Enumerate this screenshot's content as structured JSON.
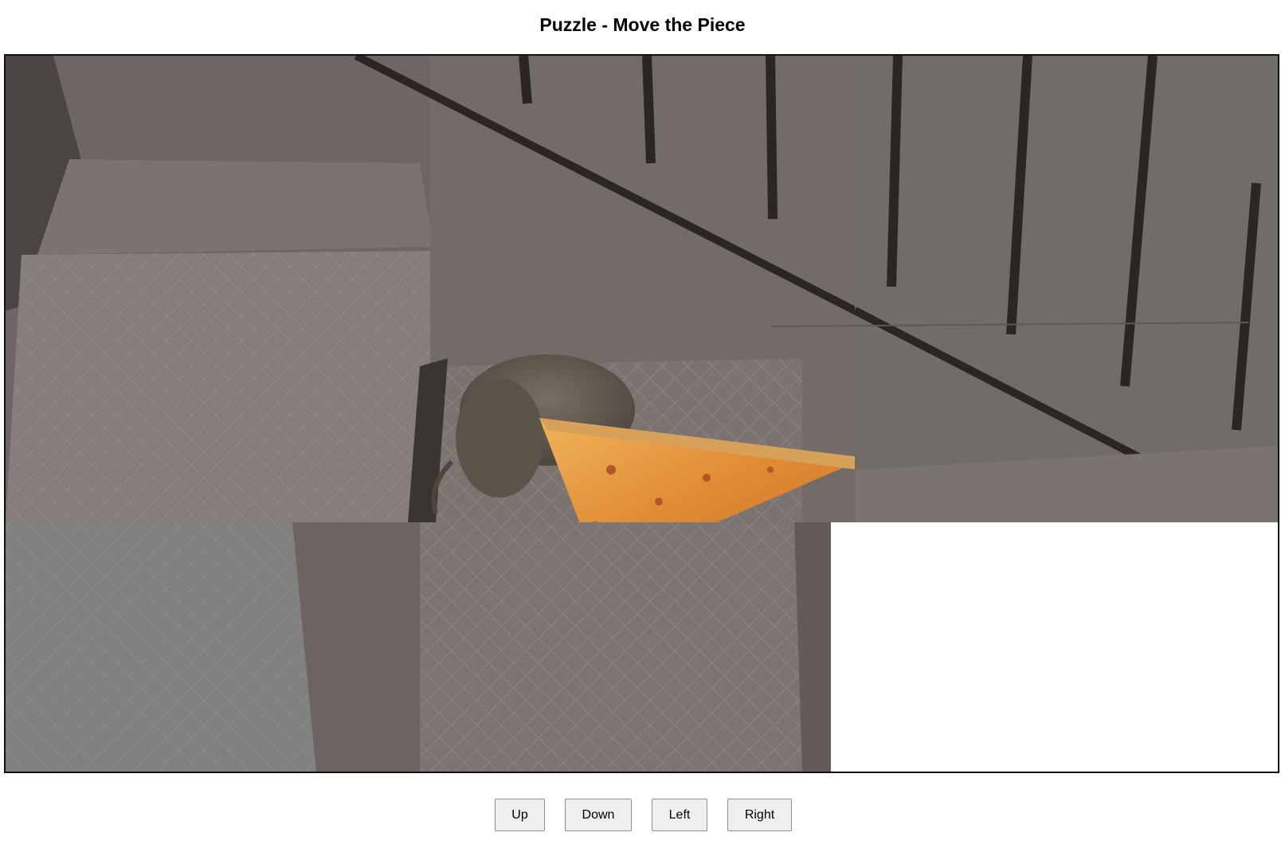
{
  "page": {
    "title": "Puzzle - Move the Piece"
  },
  "puzzle": {
    "grid": {
      "rows": 2,
      "cols": 3
    },
    "empty_slot": {
      "row": 1,
      "col": 2
    },
    "tiles": [
      {
        "row": 0,
        "col": 0,
        "content": "stairs-and-wall"
      },
      {
        "row": 0,
        "col": 1,
        "content": "rat-carrying-pizza"
      },
      {
        "row": 0,
        "col": 2,
        "content": "railing-and-landing"
      },
      {
        "row": 1,
        "col": 0,
        "content": "stair-step-corner"
      },
      {
        "row": 1,
        "col": 1,
        "content": "pizza-on-step"
      }
    ]
  },
  "controls": {
    "up_label": "Up",
    "down_label": "Down",
    "left_label": "Left",
    "right_label": "Right"
  },
  "colors": {
    "ground": "#6b6461",
    "step": "#7d7572",
    "pizza": "#e59a3c",
    "rat": "#5e554c",
    "railing": "#2a2624"
  }
}
